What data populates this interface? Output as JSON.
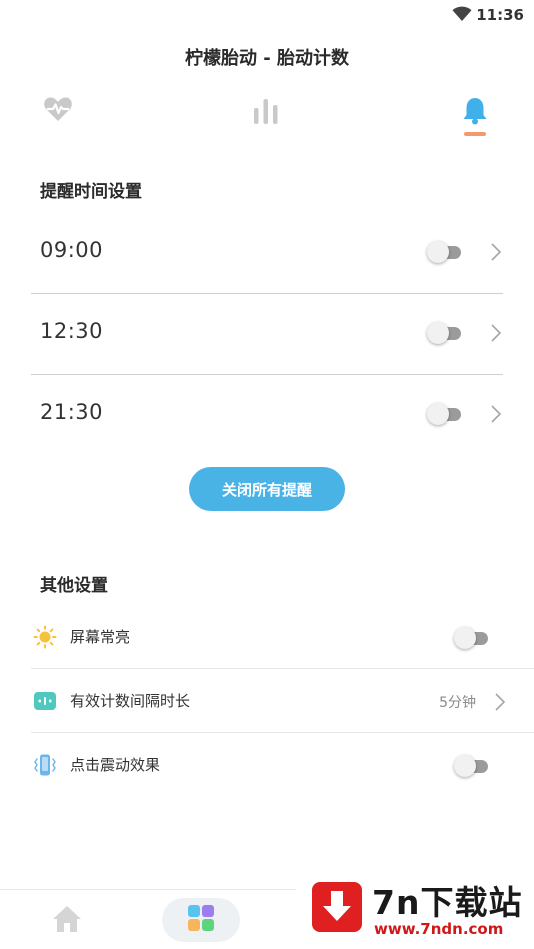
{
  "status_bar": {
    "time": "11:36"
  },
  "header": {
    "title": "柠檬胎动 - 胎动计数"
  },
  "tabs": [
    {
      "name": "heartbeat",
      "icon": "heartbeat-icon",
      "active": false
    },
    {
      "name": "stats",
      "icon": "bar-chart-icon",
      "active": false
    },
    {
      "name": "reminder",
      "icon": "bell-icon",
      "active": true
    }
  ],
  "reminders": {
    "section_title": "提醒时间设置",
    "items": [
      {
        "time": "09:00",
        "enabled": false
      },
      {
        "time": "12:30",
        "enabled": false
      },
      {
        "time": "21:30",
        "enabled": false
      }
    ],
    "close_all_label": "关闭所有提醒"
  },
  "other_settings": {
    "section_title": "其他设置",
    "items": [
      {
        "label": "屏幕常亮",
        "icon": "sun-icon",
        "type": "toggle",
        "enabled": false
      },
      {
        "label": "有效计数间隔时长",
        "icon": "timer-icon",
        "type": "select",
        "value": "5分钟"
      },
      {
        "label": "点击震动效果",
        "icon": "vibrate-icon",
        "type": "toggle",
        "enabled": false
      }
    ]
  },
  "bottom_nav": [
    {
      "name": "home",
      "icon": "home-icon"
    },
    {
      "name": "apps",
      "icon": "apps-grid-icon"
    }
  ],
  "watermark": {
    "title": "7n下载站",
    "url": "www.7ndn.com"
  },
  "colors": {
    "accent_blue": "#4ab3e6",
    "tab_indicator": "#f29a6a",
    "toggle_track": "#9b9b9b",
    "brand_red": "#e02020"
  }
}
